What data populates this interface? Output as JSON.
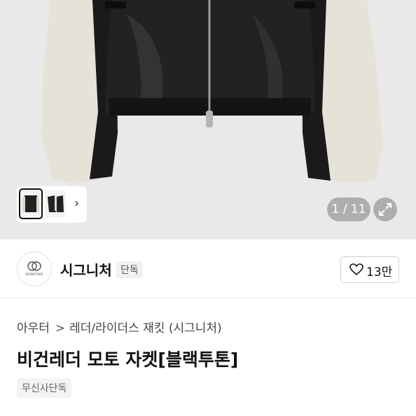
{
  "gallery": {
    "counter": "1 / 11",
    "next_icon": "chevron-right-icon",
    "expand_icon": "expand-icon"
  },
  "brand": {
    "logo_text": "SIGNATURE",
    "name": "시그니처",
    "exclusive_badge": "단독"
  },
  "like": {
    "icon": "heart-icon",
    "count": "13만"
  },
  "breadcrumb": {
    "category": "아우터",
    "separator": ">",
    "subcategory": "레더/라이더스 재킷 (시그니처)"
  },
  "product": {
    "title": "비건레더 모토 자켓[블랙투톤]",
    "tag": "무신사단독"
  },
  "colors": {
    "hero_bg": "#e9e9e9",
    "leather": "#1c1c1c",
    "sleeve_cream": "#e6e2d8"
  }
}
